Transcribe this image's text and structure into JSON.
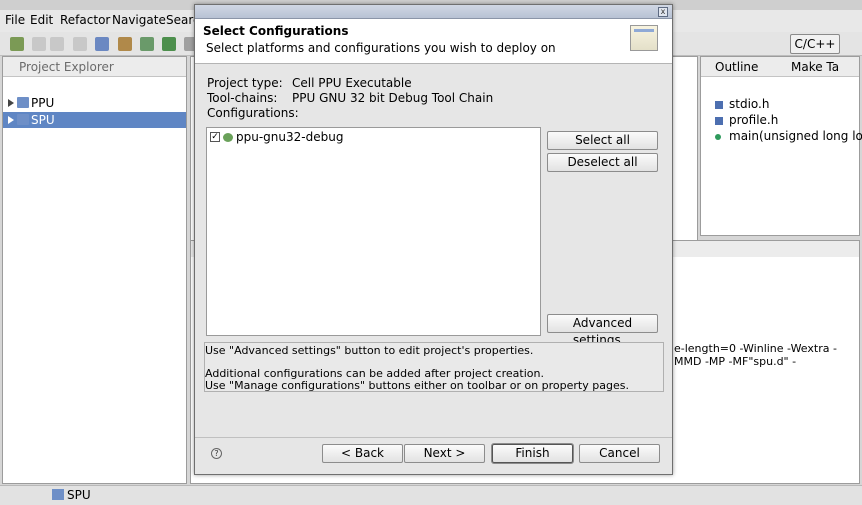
{
  "menu": [
    "File",
    "Edit",
    "Refactor",
    "Navigate",
    "Searc"
  ],
  "perspective": "C/C++",
  "project_explorer": {
    "title": "Project Explorer",
    "items": [
      {
        "label": "PPU",
        "selected": false
      },
      {
        "label": "SPU",
        "selected": true
      }
    ]
  },
  "outline": {
    "tab_outline": "Outline",
    "tab_make": "Make Ta",
    "items": [
      "stdio.h",
      "profile.h",
      "main(unsigned long long)"
    ]
  },
  "console": {
    "lines": [
      "e-length=0 -Winline -Wextra -",
      "MMD -MP -MF\"spu.d\" -"
    ]
  },
  "statusbar": {
    "label": "SPU"
  },
  "dialog": {
    "title": "Select Configurations",
    "subtitle": "Select platforms and configurations you wish to deploy on",
    "project_type_label": "Project type:",
    "project_type_value": "Cell PPU Executable",
    "toolchains_label": "Tool-chains:",
    "toolchains_value": "PPU GNU 32 bit Debug Tool Chain",
    "configurations_label": "Configurations:",
    "configurations": [
      {
        "label": "ppu-gnu32-debug",
        "checked": true
      }
    ],
    "select_all": "Select all",
    "deselect_all": "Deselect all",
    "advanced": "Advanced settings...",
    "messages": [
      "Use \"Advanced settings\" button to edit project's properties.",
      "",
      "Additional configurations can be added after project creation.",
      "Use \"Manage configurations\" buttons either on toolbar or on property pages."
    ],
    "back": "< Back",
    "next": "Next >",
    "finish": "Finish",
    "cancel": "Cancel",
    "help_glyph": "?",
    "close_glyph": "x"
  }
}
